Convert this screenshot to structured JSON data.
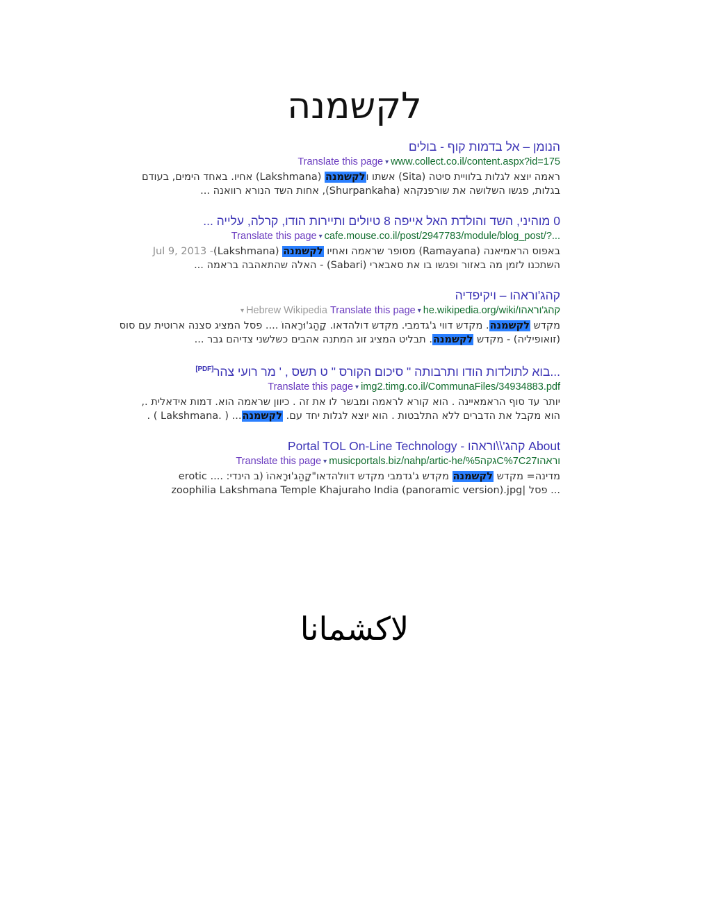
{
  "document": {
    "top_heading": "לקשמנה",
    "bottom_heading": "لاكشمانا"
  },
  "labels": {
    "translate": "Translate this page",
    "caret": "▾",
    "pdf_tag": "[PDF]"
  },
  "colors": {
    "title_link": "#3b33b5",
    "url_green": "#006621",
    "translate_purple": "#6a3bbf",
    "highlight_blue": "#2a7fff",
    "grey_meta": "#9b9b9b",
    "snippet_text": "#333333"
  },
  "results": [
    {
      "title": "הנומן – אל בדמות קוף - בולים",
      "has_pdf_tag": false,
      "url": "www.collect.co.il/content.aspx?id=175",
      "site_label": "",
      "snippet_line1_a": "ראמה יוצא לגלות בלוויית סיטה (Sita) אשתו ו",
      "snippet_line1_hl": "לקשמנה",
      "snippet_line1_b": " (Lakshmana) אחיו. באחד הימים, בעודם",
      "snippet_line2": "בגלות, פגשו השלושה את שורפנקהא (Shurpankaha), אחות השד הנורא רוואנה ..."
    },
    {
      "title": "0 מוהיני, השד והולדת האל אייפה 8 טיולים ותיירות הודו, קרלה, עלייה ...",
      "has_pdf_tag": false,
      "url": "cafe.mouse.co.il/post/2947783/module/blog_post/?...",
      "site_label": "",
      "date": "Jul 9, 2013 - ",
      "snippet_line1_a": "באפוס הראמיאנה (Ramayana) מסופר שראמה ואחיו ",
      "snippet_line1_hl": "לקשמנה",
      "snippet_line1_b": " (Lakshmana)",
      "snippet_line2": "השתכנו לזמן מה באזור ופגשו בו את סאבארי (Sabari) - האלה שהתאהבה בראמה ..."
    },
    {
      "title": "קהג'וראהו – ויקיפדיה",
      "has_pdf_tag": false,
      "url": "he.wikipedia.org/wiki/קהג'וראהו",
      "site_label": "Hebrew Wikipedia",
      "snippet_line1_a": "מקדש ",
      "snippet_line1_hl": "לקשמנה",
      "snippet_line1_b": ". מקדש דווי ג'גדמבי. מקדש דולהדאו. קָהַג'וּרָאהוֹ .... פסל המציג סצנה ארוטית עם סוס",
      "snippet_line2_a": "(זואופיליה) - מקדש ",
      "snippet_line2_hl": "לקשמנה",
      "snippet_line2_b": ". תבליט המציג זוג המתנה אהבים כשלשני צדיהם גבר ..."
    },
    {
      "title": "...בוא לתולדות הודו ותרבותה \" סיכום הקורס \" ט תשס , ' מר רועי צהר",
      "has_pdf_tag": true,
      "url": "img2.timg.co.il/CommunaFiles/34934883.pdf",
      "site_label": "",
      "snippet_line1": "יותר עד סוף הראמאיינה . הוא קורא לראמה ומבשר לו את זה . כיוון שראמה הוא. דמות אידאלית .,",
      "snippet_line2_a": "הוא מקבל את הדברים ללא התלבטות . הוא יוצא לגלות יחד עם. ",
      "snippet_line2_hl": "לקשמנה",
      "snippet_line2_b": ". ( Lakshmana. ) ..."
    },
    {
      "title": "About קהג'\\\\וראהו - Portal TOL On-Line Technology",
      "has_pdf_tag": false,
      "url": "musicportals.biz/nahp/artic-he/%5גקהC%7C27וראהו",
      "site_label": "",
      "snippet_line1_a": "מדינה= מקדש ",
      "snippet_line1_hl": "לקשמנה",
      "snippet_line1_b": " מקדש ג'גדמבי מקדש דוולהדאו\"קָהַג'וּרָאהוֹ (ב הינדי: .... erotic",
      "snippet_line2": "... פסל |zoophilia Lakshmana Temple Khajuraho India (panoramic version).jpg"
    }
  ]
}
